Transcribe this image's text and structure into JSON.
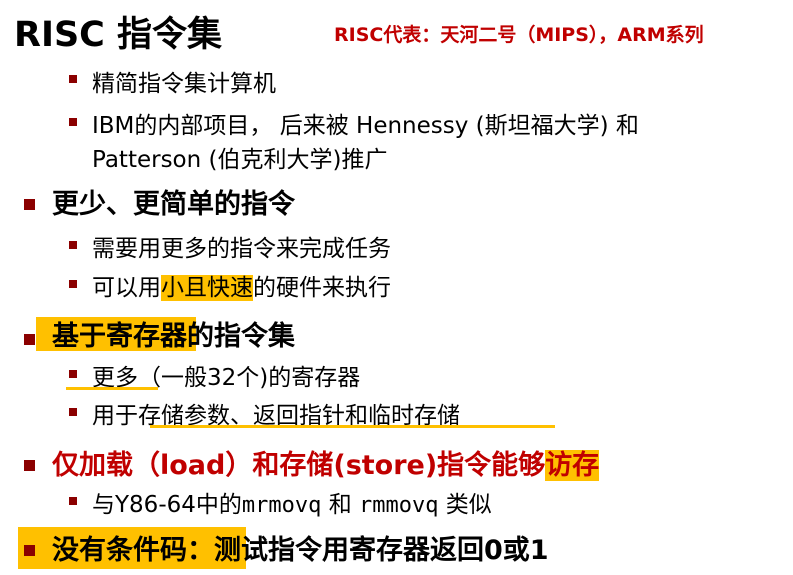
{
  "title": "RISC 指令集",
  "subtitle": "RISC代表：天河二号（MIPS），ARM系列",
  "items": [
    {
      "level": 2,
      "text": "精简指令集计算机"
    },
    {
      "level": 2,
      "text": "IBM的内部项目， 后来被 Hennessy (斯坦福大学) 和"
    },
    {
      "level": 2,
      "text": "Patterson (伯克利大学)推广"
    },
    {
      "level": 1,
      "text": "更少、更简单的指令"
    },
    {
      "level": 2,
      "text": "需要用更多的指令来完成任务"
    },
    {
      "level": 2,
      "pre": "可以用",
      "hl": "小且快速",
      "post": "的硬件来执行"
    },
    {
      "level": 1,
      "hl": "基于寄存器",
      "post": "的指令集"
    },
    {
      "level": 2,
      "pre": "更多",
      "post": "（一般32个)的寄存器"
    },
    {
      "level": 2,
      "text": "用于存储参数、返回指针和临时存储"
    },
    {
      "level": 1,
      "pre": "仅加载（load）和存储(store)指令能够",
      "hl": "访存"
    },
    {
      "level": 2,
      "a": "与Y86-64中的",
      "code1": "mrmovq",
      "b": "和",
      "code2": "rmmovq",
      "c": "类似"
    },
    {
      "level": 1,
      "hl": "没有条件码：",
      "post": "测试指令用寄存器返回0或1"
    }
  ],
  "colors": {
    "bullet": "#8b0000",
    "highlight": "#ffc000",
    "accent_red": "#c00000"
  }
}
